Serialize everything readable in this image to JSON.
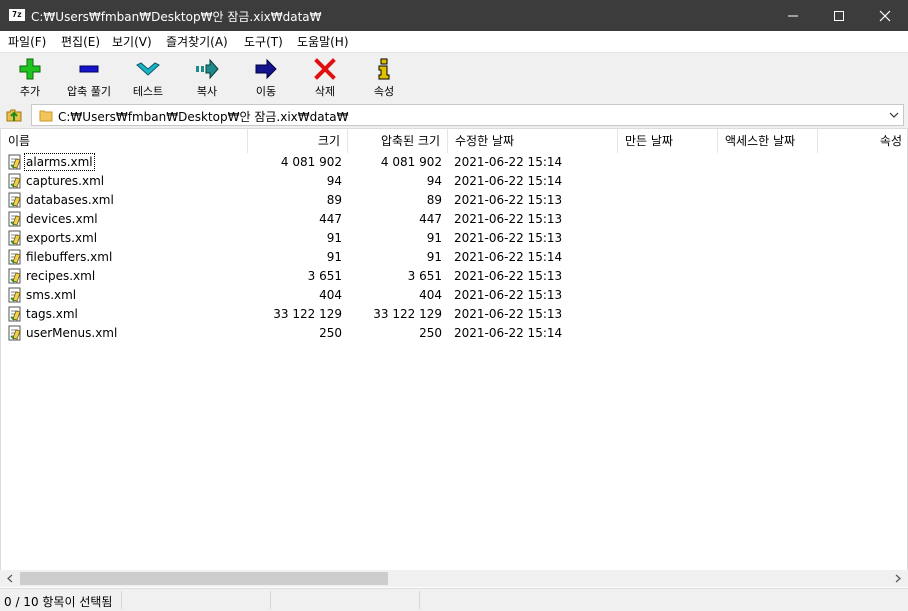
{
  "window": {
    "title": "C:₩Users₩fmban₩Desktop₩안 잠금.xix₩data₩",
    "app_icon": "7z"
  },
  "menu": [
    "파일(F)",
    "편집(E)",
    "보기(V)",
    "즐겨찾기(A)",
    "도구(T)",
    "도움말(H)"
  ],
  "toolbar": [
    {
      "label": "추가",
      "icon": "add-icon",
      "color": "#1fc41f"
    },
    {
      "label": "압축 풀기",
      "icon": "extract-icon",
      "color": "#1414c8"
    },
    {
      "label": "테스트",
      "icon": "test-icon",
      "color": "#19b4c8"
    },
    {
      "label": "복사",
      "icon": "copy-icon",
      "color": "#1e8a8a"
    },
    {
      "label": "이동",
      "icon": "move-icon",
      "color": "#14148c"
    },
    {
      "label": "삭제",
      "icon": "delete-icon",
      "color": "#e01010"
    },
    {
      "label": "속성",
      "icon": "info-icon",
      "color": "#e0c000"
    }
  ],
  "address": {
    "path": "C:₩Users₩fmban₩Desktop₩안 잠금.xix₩data₩"
  },
  "columns": [
    "이름",
    "크기",
    "압축된 크기",
    "수정한 날짜",
    "만든 날짜",
    "액세스한 날짜",
    "속성"
  ],
  "files": [
    {
      "name": "alarms.xml",
      "size": "4 081 902",
      "packed": "4 081 902",
      "modified": "2021-06-22 15:14"
    },
    {
      "name": "captures.xml",
      "size": "94",
      "packed": "94",
      "modified": "2021-06-22 15:14"
    },
    {
      "name": "databases.xml",
      "size": "89",
      "packed": "89",
      "modified": "2021-06-22 15:13"
    },
    {
      "name": "devices.xml",
      "size": "447",
      "packed": "447",
      "modified": "2021-06-22 15:13"
    },
    {
      "name": "exports.xml",
      "size": "91",
      "packed": "91",
      "modified": "2021-06-22 15:13"
    },
    {
      "name": "filebuffers.xml",
      "size": "91",
      "packed": "91",
      "modified": "2021-06-22 15:14"
    },
    {
      "name": "recipes.xml",
      "size": "3 651",
      "packed": "3 651",
      "modified": "2021-06-22 15:13"
    },
    {
      "name": "sms.xml",
      "size": "404",
      "packed": "404",
      "modified": "2021-06-22 15:13"
    },
    {
      "name": "tags.xml",
      "size": "33 122 129",
      "packed": "33 122 129",
      "modified": "2021-06-22 15:13"
    },
    {
      "name": "userMenus.xml",
      "size": "250",
      "packed": "250",
      "modified": "2021-06-22 15:14"
    }
  ],
  "status": {
    "selection": "0 / 10 항목이 선택됨"
  }
}
